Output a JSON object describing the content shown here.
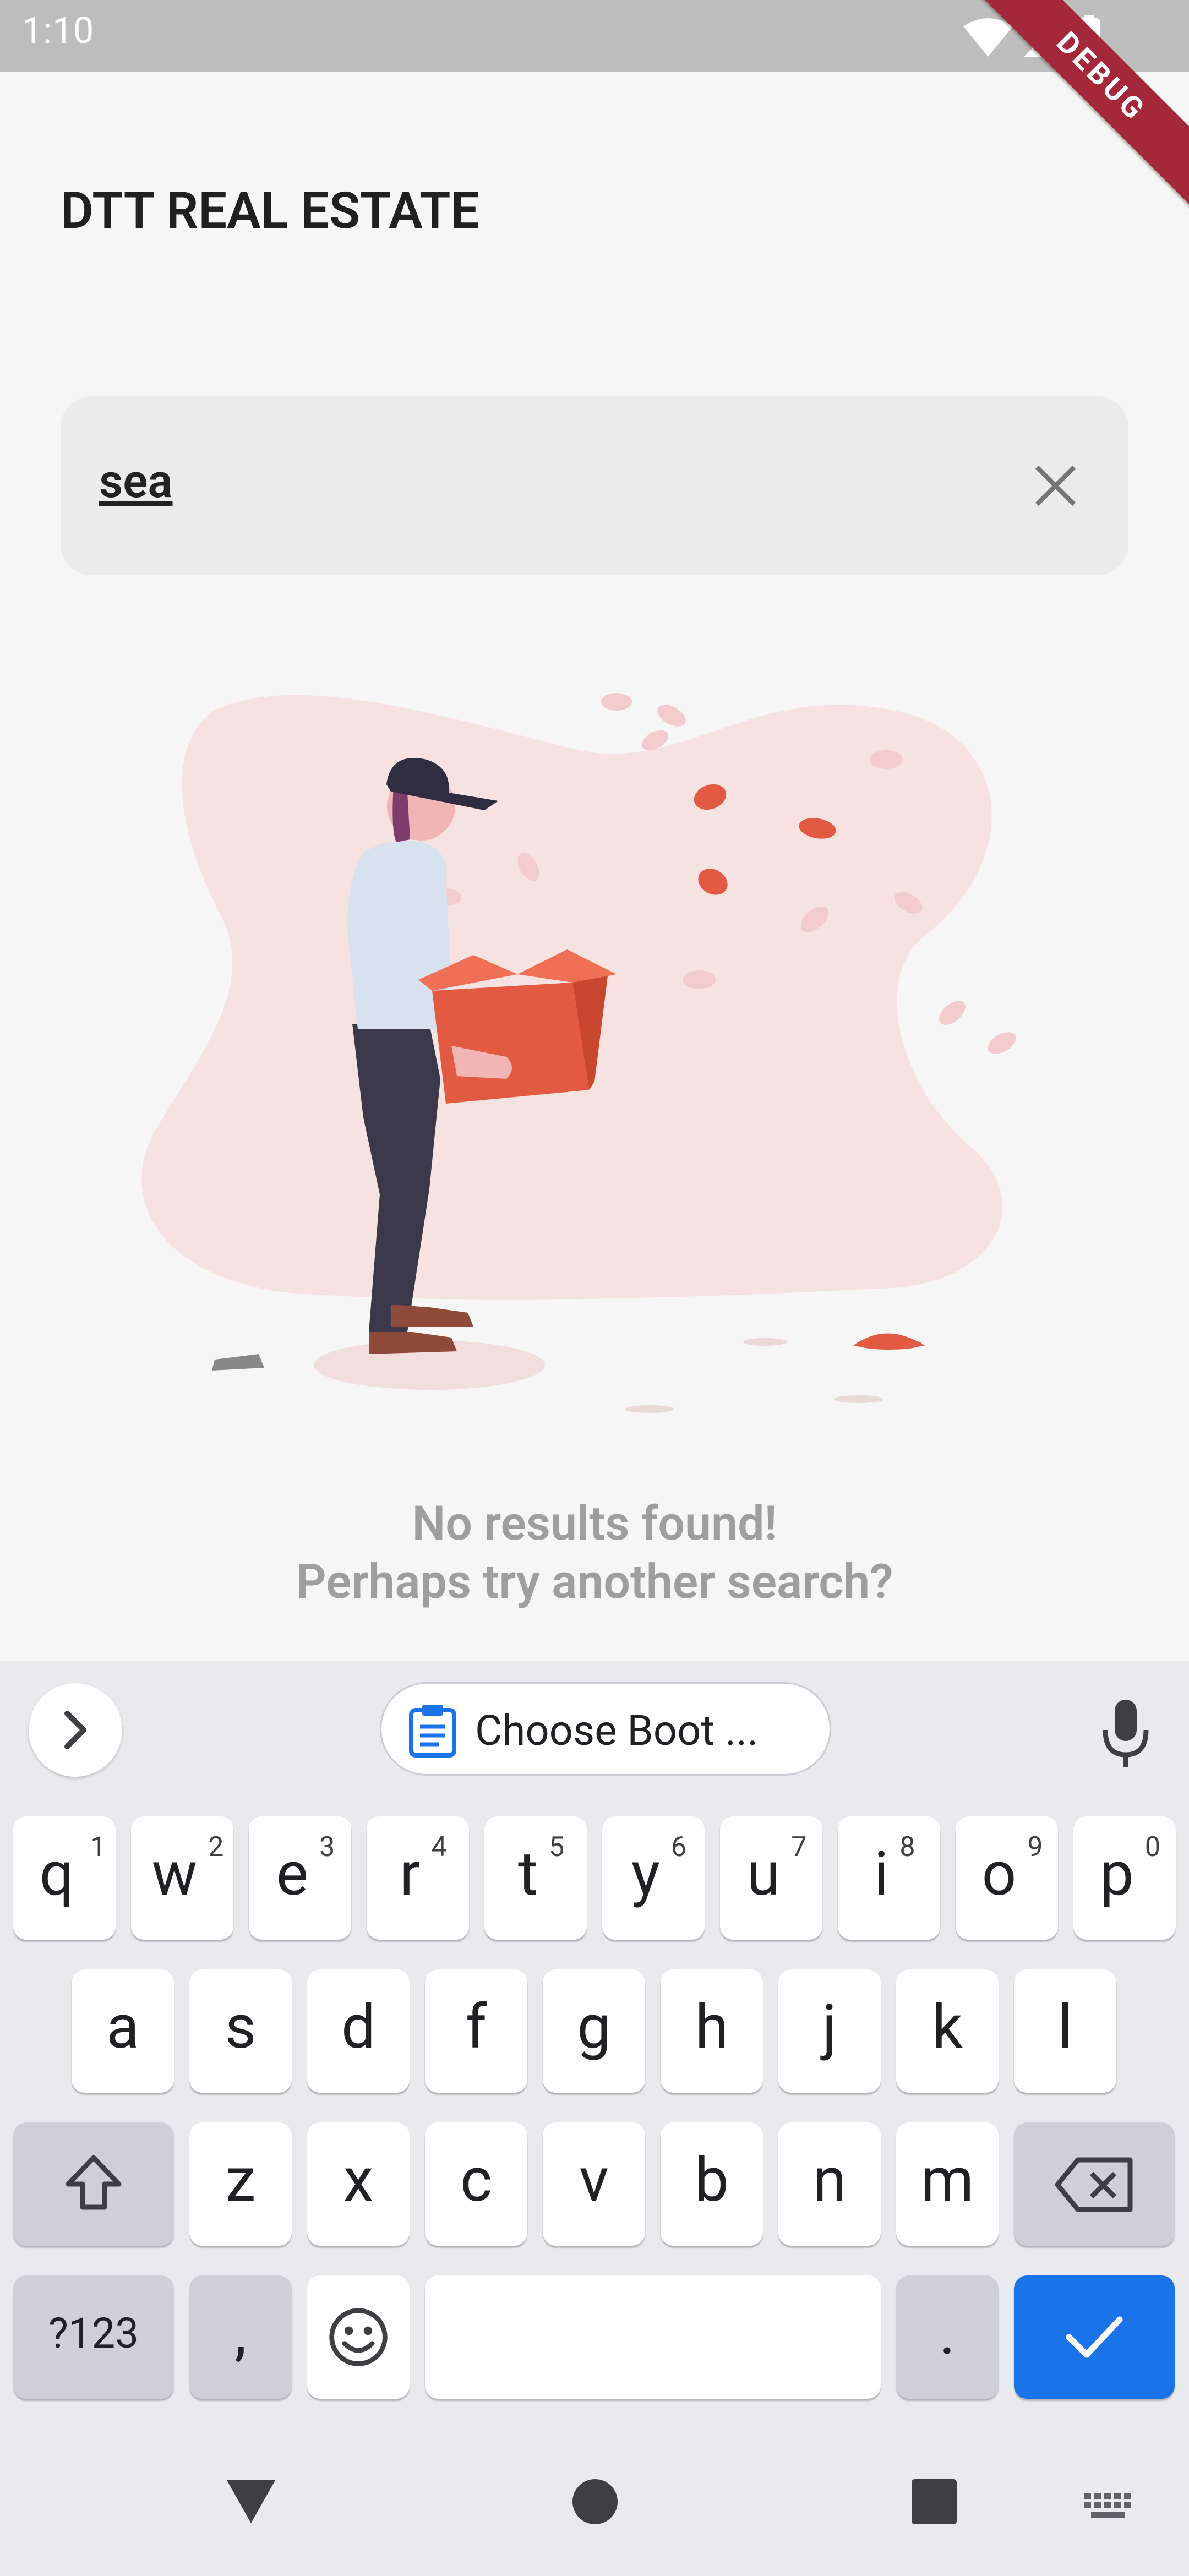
{
  "status_bar": {
    "time": "1:10"
  },
  "debug_banner": "DEBUG",
  "app": {
    "title": "DTT REAL ESTATE"
  },
  "search": {
    "value": "sea"
  },
  "empty_state": {
    "line1": "No results found!",
    "line2": "Perhaps try another search?"
  },
  "keyboard": {
    "clipboard_suggestion": "Choose Boot ...",
    "row1": [
      {
        "key": "q",
        "hint": "1"
      },
      {
        "key": "w",
        "hint": "2"
      },
      {
        "key": "e",
        "hint": "3"
      },
      {
        "key": "r",
        "hint": "4"
      },
      {
        "key": "t",
        "hint": "5"
      },
      {
        "key": "y",
        "hint": "6"
      },
      {
        "key": "u",
        "hint": "7"
      },
      {
        "key": "i",
        "hint": "8"
      },
      {
        "key": "o",
        "hint": "9"
      },
      {
        "key": "p",
        "hint": "0"
      }
    ],
    "row2": [
      "a",
      "s",
      "d",
      "f",
      "g",
      "h",
      "j",
      "k",
      "l"
    ],
    "row3": [
      "z",
      "x",
      "c",
      "v",
      "b",
      "n",
      "m"
    ],
    "symbols_label": "?123",
    "comma": ",",
    "period": "."
  },
  "colors": {
    "accent": "#1a73e8",
    "brand_red": "#e25a41",
    "debug_red": "#a4283a"
  }
}
